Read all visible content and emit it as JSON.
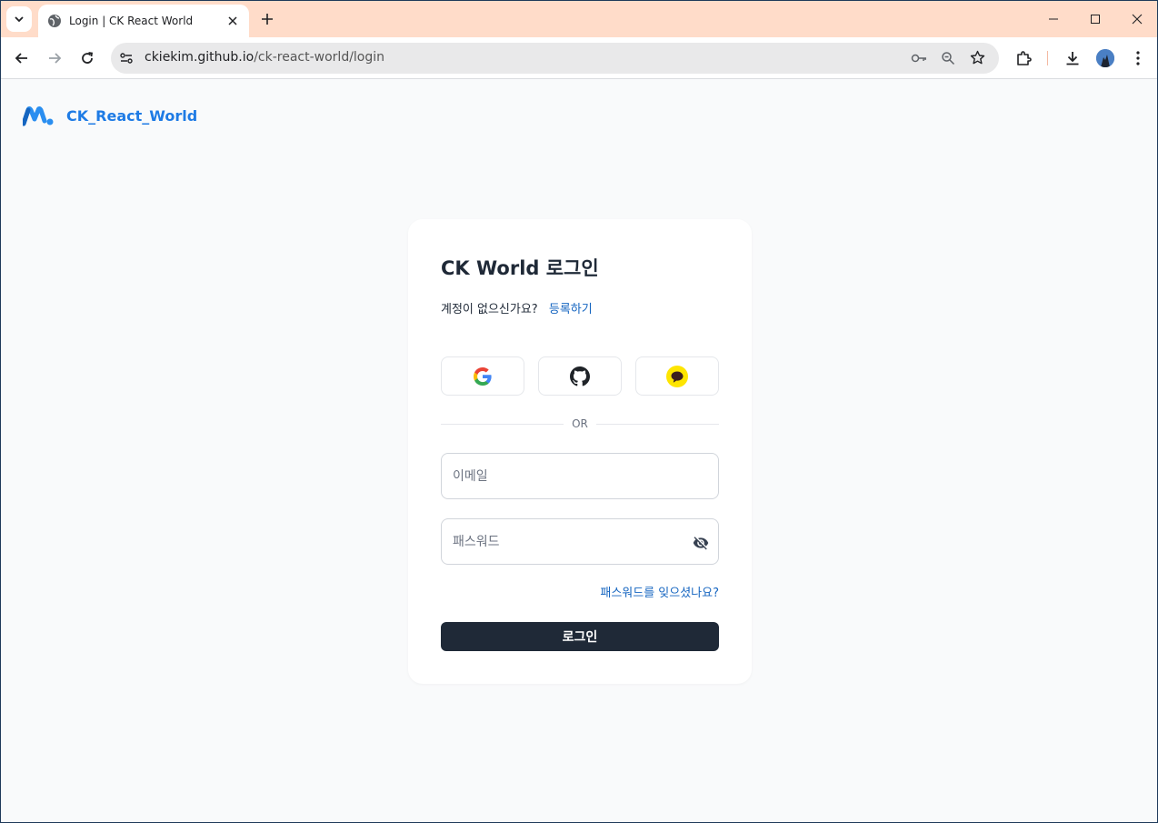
{
  "browser": {
    "tab_title": "Login | CK React World",
    "url_host": "ckiekim.github.io",
    "url_path": "/ck-react-world/login"
  },
  "header": {
    "brand_name": "CK_React_World"
  },
  "login": {
    "title": "CK World 로그인",
    "signup_prompt": "계정이 없으신가요?",
    "signup_link": "등록하기",
    "divider_text": "OR",
    "email_placeholder": "이메일",
    "password_placeholder": "패스워드",
    "forgot_link": "패스워드를 잊으셨나요?",
    "submit_label": "로그인"
  },
  "colors": {
    "brand": "#1e7be5",
    "link": "#1565c0",
    "button": "#1f2937",
    "titlebar": "#ffdcc9"
  }
}
